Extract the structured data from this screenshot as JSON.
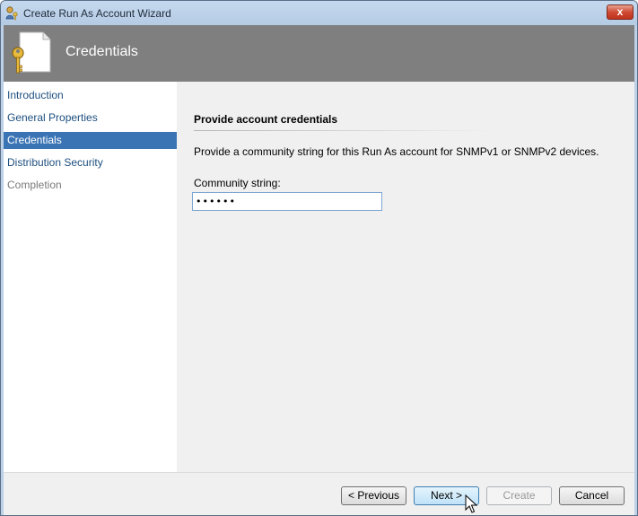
{
  "window": {
    "title": "Create Run As Account Wizard",
    "close_label": "x"
  },
  "banner": {
    "title": "Credentials"
  },
  "nav": {
    "items": [
      {
        "label": "Introduction",
        "state": "normal"
      },
      {
        "label": "General Properties",
        "state": "normal"
      },
      {
        "label": "Credentials",
        "state": "active"
      },
      {
        "label": "Distribution Security",
        "state": "normal"
      },
      {
        "label": "Completion",
        "state": "disabled"
      }
    ]
  },
  "content": {
    "heading": "Provide account credentials",
    "description": "Provide a community string for this Run As account for SNMPv1 or SNMPv2 devices.",
    "community_label": "Community string:",
    "community_value": "••••••"
  },
  "footer": {
    "previous_label": "< Previous",
    "next_label": "Next >",
    "create_label": "Create",
    "cancel_label": "Cancel"
  },
  "colors": {
    "nav_active": "#3a74b5",
    "banner": "#7f7f7f",
    "link": "#1d4f7f"
  }
}
